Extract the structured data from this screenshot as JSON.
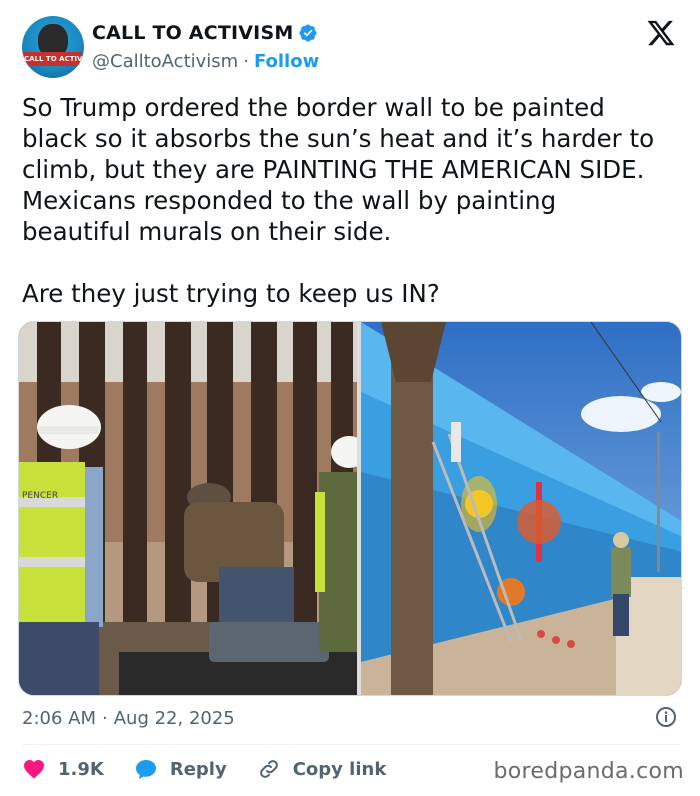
{
  "author": {
    "display_name": "CALL TO ACTIVISM",
    "handle": "@CalltoActivism",
    "separator": "·",
    "follow_label": "Follow",
    "avatar_banner_text": "CALL TO ACTIVISM",
    "verified_color": "#1d9bf0"
  },
  "tweet": {
    "text": "So Trump ordered the border wall to be painted black so it absorbs the sun’s heat and it’s harder to climb, but they are PAINTING THE AMERICAN SIDE. Mexicans responded to the wall by painting beautiful murals on their side.\n\nAre they just trying to keep us IN?",
    "time": "2:06 AM",
    "separator": "·",
    "date": "Aug 22, 2025"
  },
  "media": {
    "left_image_icon": "photo-border-wall-painting-black",
    "right_image_icon": "photo-border-wall-murals",
    "vest_text": "PENCER"
  },
  "actions": {
    "like_count": "1.9K",
    "reply_label": "Reply",
    "copy_link_label": "Copy link",
    "like_color": "#f91880",
    "reply_color": "#1d9bf0"
  },
  "watermark": "boredpanda.com",
  "icons": {
    "x_logo": "x-logo-icon",
    "info": "info-icon",
    "heart": "heart-icon",
    "reply": "reply-bubble-icon",
    "link": "link-icon"
  }
}
